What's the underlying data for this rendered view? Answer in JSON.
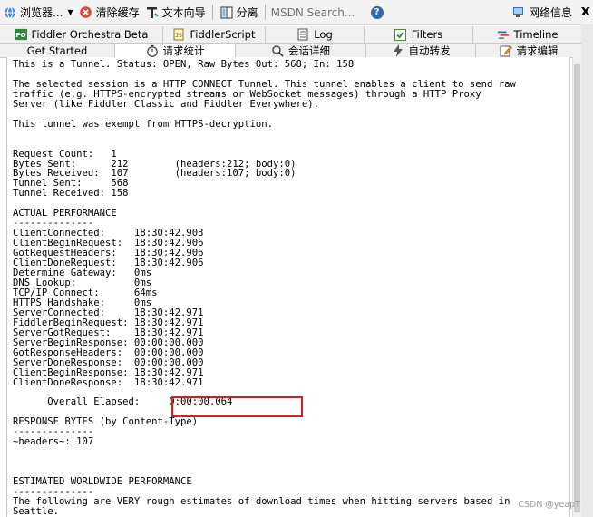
{
  "toolbar": {
    "browser_label": "浏览器...",
    "clear_cache_label": "清除缓存",
    "text_wizard_label": "文本向导",
    "split_label": "分离",
    "search_placeholder": "MSDN Search...",
    "network_info_label": "网络信息",
    "close_label": "x"
  },
  "tabs_top": [
    {
      "label": "Fiddler Orchestra Beta",
      "icon": "fiddler-orchestra-icon"
    },
    {
      "label": "FiddlerScript",
      "icon": "script-icon"
    },
    {
      "label": "Log",
      "icon": "log-icon"
    },
    {
      "label": "Filters",
      "icon": "filter-checkbox-icon"
    },
    {
      "label": "Timeline",
      "icon": "timeline-icon"
    }
  ],
  "tabs_bottom": [
    {
      "label": "Get Started",
      "icon": ""
    },
    {
      "label": "请求统计",
      "icon": "stopwatch-icon",
      "active": true
    },
    {
      "label": "会话详细",
      "icon": "inspectors-icon"
    },
    {
      "label": "自动转发",
      "icon": "lightning-icon"
    },
    {
      "label": "请求编辑",
      "icon": "composer-icon"
    }
  ],
  "report_text": "This is a Tunnel. Status: OPEN, Raw Bytes Out: 568; In: 158\n\nThe selected session is a HTTP CONNECT Tunnel. This tunnel enables a client to send raw\ntraffic (e.g. HTTPS-encrypted streams or WebSocket messages) through a HTTP Proxy\nServer (like Fiddler Classic and Fiddler Everywhere).\n\nThis tunnel was exempt from HTTPS-decryption.\n\n\nRequest Count:   1\nBytes Sent:      212        (headers:212; body:0)\nBytes Received:  107        (headers:107; body:0)\nTunnel Sent:     568\nTunnel Received: 158\n\nACTUAL PERFORMANCE\n--------------\nClientConnected:     18:30:42.903\nClientBeginRequest:  18:30:42.906\nGotRequestHeaders:   18:30:42.906\nClientDoneRequest:   18:30:42.906\nDetermine Gateway:   0ms\nDNS Lookup:          0ms\nTCP/IP Connect:      64ms\nHTTPS Handshake:     0ms\nServerConnected:     18:30:42.971\nFiddlerBeginRequest: 18:30:42.971\nServerGotRequest:    18:30:42.971\nServerBeginResponse: 00:00:00.000\nGotResponseHeaders:  00:00:00.000\nServerDoneResponse:  00:00:00.000\nClientBeginResponse: 18:30:42.971\nClientDoneResponse:  18:30:42.971\n\n      Overall Elapsed:     0:00:00.064\n\nRESPONSE BYTES (by Content-Type)\n--------------\n~headers~: 107\n\n\n\nESTIMATED WORLDWIDE PERFORMANCE\n--------------\nThe following are VERY rough estimates of download times when hitting servers based in\nSeattle.",
  "watermark": "CSDN @yeapT",
  "colors": {
    "highlight_border": "#d21f1f",
    "toolbar_bg": "#f3f3f3",
    "tab_bg": "#f0f0f0"
  }
}
